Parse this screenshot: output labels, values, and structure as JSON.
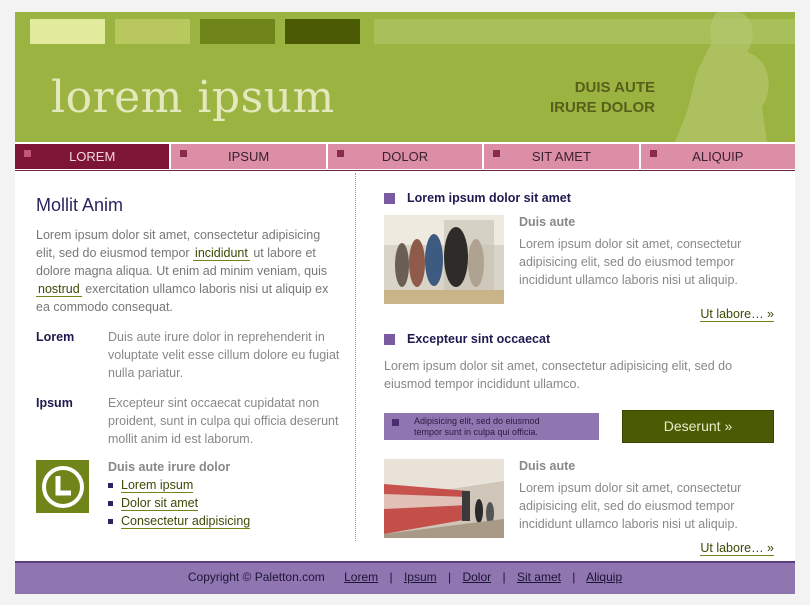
{
  "header": {
    "logo": "lorem ipsum",
    "tagline_line1": "DUIS AUTE",
    "tagline_line2": "IRURE DOLOR",
    "palette": [
      "#e2eb9d",
      "#b8c75e",
      "#6f8419",
      "#4b5b04"
    ]
  },
  "nav": {
    "items": [
      {
        "label": "LOREM",
        "active": true
      },
      {
        "label": "IPSUM"
      },
      {
        "label": "DOLOR"
      },
      {
        "label": "SIT AMET"
      },
      {
        "label": "ALIQUIP"
      }
    ]
  },
  "left": {
    "title": "Mollit Anim",
    "intro_part1": "Lorem ipsum dolor sit amet, consectetur adipisicing elit, sed do eiusmod tempor",
    "intro_hl1": "incididunt",
    "intro_part2": "ut labore et dolore magna aliqua. Ut enim ad minim veniam, quis",
    "intro_hl2": "nostrud",
    "intro_part3": "exercitation ullamco laboris nisi ut aliquip ex ea commodo consequat.",
    "defs": [
      {
        "term": "Lorem",
        "desc": "Duis aute irure dolor in reprehenderit in voluptate velit esse cillum dolore eu fugiat nulla pariatur."
      },
      {
        "term": "Ipsum",
        "desc": "Excepteur sint occaecat cupidatat non proident, sunt in culpa qui officia deserunt mollit anim id est laborum."
      }
    ],
    "links_title": "Duis aute irure dolor",
    "links": [
      "Lorem ipsum",
      "Dolor sit amet",
      "Consectetur adipisicing"
    ]
  },
  "right": {
    "section1_title": "Lorem ipsum dolor sit amet",
    "feature1": {
      "title": "Duis aute",
      "text": "Lorem ipsum dolor sit amet, consectetur adipisicing elit, sed do eiusmod tempor incididunt ullamco laboris nisi ut aliquip.",
      "more": "Ut labore… »"
    },
    "section2_title": "Excepteur sint occaecat",
    "section2_text": "Lorem ipsum dolor sit amet, consectetur adipisicing elit, sed do eiusmod tempor incididunt ullamco.",
    "promo_line1": "Adipisicing elit, sed do eiusmod",
    "promo_line2": "tempor sunt in culpa qui officia.",
    "cta": "Deserunt »",
    "feature2": {
      "title": "Duis aute",
      "text": "Lorem ipsum dolor sit amet, consectetur adipisicing elit, sed do eiusmod tempor incididunt ullamco laboris nisi ut aliquip.",
      "more": "Ut labore… »"
    }
  },
  "footer": {
    "copyright": "Copyright © Paletton.com",
    "links": [
      "Lorem",
      "Ipsum",
      "Dolor",
      "Sit amet",
      "Aliquip"
    ]
  }
}
